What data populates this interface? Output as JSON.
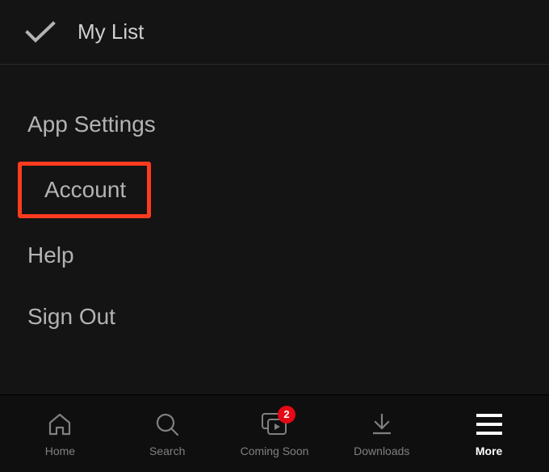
{
  "top": {
    "my_list_label": "My List"
  },
  "settings": {
    "items": [
      {
        "label": "App Settings",
        "highlighted": false
      },
      {
        "label": "Account",
        "highlighted": true
      },
      {
        "label": "Help",
        "highlighted": false
      },
      {
        "label": "Sign Out",
        "highlighted": false
      }
    ]
  },
  "nav": {
    "items": [
      {
        "label": "Home"
      },
      {
        "label": "Search"
      },
      {
        "label": "Coming Soon",
        "badge": "2"
      },
      {
        "label": "Downloads"
      },
      {
        "label": "More",
        "active": true
      }
    ]
  }
}
